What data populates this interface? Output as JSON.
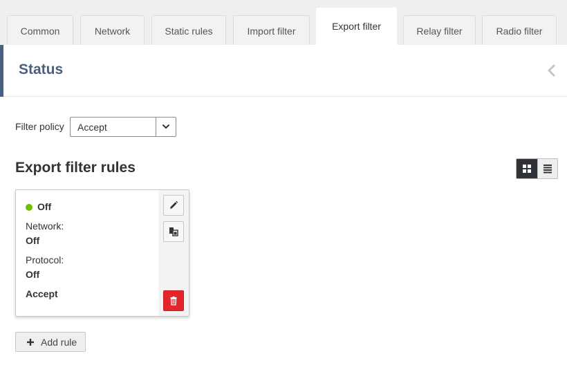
{
  "tabs": [
    {
      "label": "Common",
      "active": false
    },
    {
      "label": "Network",
      "active": false
    },
    {
      "label": "Static rules",
      "active": false
    },
    {
      "label": "Import filter",
      "active": false
    },
    {
      "label": "Export filter",
      "active": true
    },
    {
      "label": "Relay filter",
      "active": false
    },
    {
      "label": "Radio filter",
      "active": false
    }
  ],
  "status": {
    "title": "Status",
    "collapse_icon": "chevron-left-icon"
  },
  "filter_policy": {
    "label": "Filter policy",
    "value": "Accept",
    "caret_icon": "chevron-down-icon"
  },
  "rules": {
    "title": "Export filter rules",
    "view_modes": [
      "grid-view-icon",
      "list-view-icon"
    ],
    "active_view": "grid",
    "items": [
      {
        "state": "Off",
        "state_color": "#6cc000",
        "network_label": "Network:",
        "network_value": "Off",
        "protocol_label": "Protocol:",
        "protocol_value": "Off",
        "action": "Accept",
        "actions": [
          "edit-icon",
          "duplicate-icon",
          "trash-icon"
        ]
      }
    ]
  },
  "add_rule": {
    "label": "Add rule",
    "icon": "plus-icon"
  },
  "colors": {
    "accent": "#4b5f7e",
    "danger": "#e3262b",
    "status_on": "#6cc000",
    "toggle_active": "#2f3337"
  }
}
